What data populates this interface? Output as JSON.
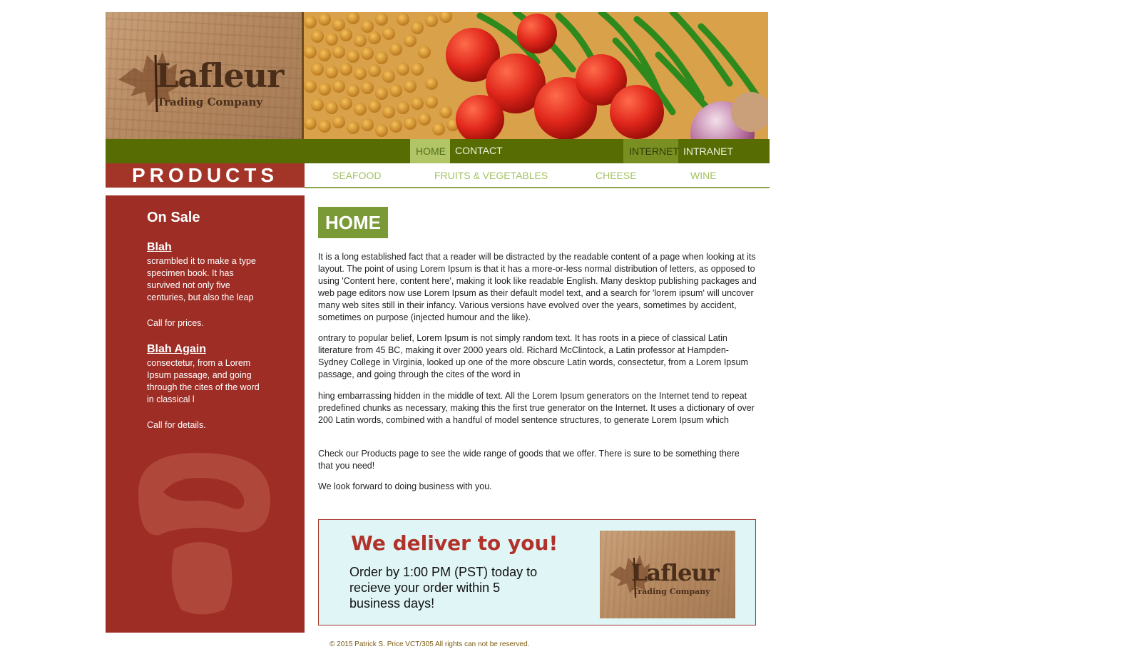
{
  "header": {
    "brand_name": "Lafleur",
    "brand_sub": "Trading Company"
  },
  "topnav": {
    "items": [
      {
        "label": "HOME",
        "state": "active"
      },
      {
        "label": "CONTACT",
        "state": "normal"
      },
      {
        "label": "INTERNET",
        "state": "muted"
      },
      {
        "label": "INTRANET",
        "state": "normal"
      }
    ]
  },
  "products": {
    "title": "PRODUCTS",
    "categories": [
      "SEAFOOD",
      "FRUITS & VEGETABLES",
      "CHEESE",
      "WINE"
    ]
  },
  "sidebar": {
    "heading": "On Sale",
    "items": [
      {
        "link": "Blah",
        "text": "scrambled it to make a type specimen book. It has survived not only five centuries, but also the leap",
        "note": "Call for prices."
      },
      {
        "link": "Blah Again",
        "text": "consectetur, from a Lorem Ipsum passage, and going through the cites of the word in classical l",
        "note": "Call for details."
      }
    ],
    "decor_icon": "mushroom-icon"
  },
  "main": {
    "title": "HOME",
    "paragraphs": [
      "It is a long established fact that a reader will be distracted by the readable content of a page when looking at its layout. The point of using Lorem Ipsum is that it has a more-or-less normal distribution of letters, as opposed to using 'Content here, content here', making it look like readable English. Many desktop publishing packages and web page editors now use Lorem Ipsum as their default model text, and a search for 'lorem ipsum' will uncover many web sites still in their infancy. Various versions have evolved over the years, sometimes by accident, sometimes on purpose (injected humour and the like).",
      "ontrary to popular belief, Lorem Ipsum is not simply random text. It has roots in a piece of classical Latin literature from 45 BC, making it over 2000 years old. Richard McClintock, a Latin professor at Hampden-Sydney College in Virginia, looked up one of the more obscure Latin words, consectetur, from a Lorem Ipsum passage, and going through the cites of the word in",
      "hing embarrassing hidden in the middle of text. All the Lorem Ipsum generators on the Internet tend to repeat predefined chunks as necessary, making this the first true generator on the Internet. It uses a dictionary of over 200 Latin words, combined with a handful of model sentence structures, to generate Lorem Ipsum which",
      "Check our Products page to see the wide range of goods that we offer. There is sure to be something there that you need!",
      "We look forward to doing business with you."
    ]
  },
  "delivery": {
    "heading": "We deliver to you!",
    "body": "Order by 1:00 PM (PST) today to recieve your order within 5 business days!"
  },
  "footer": {
    "text": "© 2015 Patrick S. Price VCT/305 All rights can not be reserved."
  },
  "colors": {
    "nav_green": "#576d04",
    "active_green": "#b1c567",
    "brick_red": "#a33428",
    "title_green": "#7a9a37",
    "category_green": "#a6c164",
    "delivery_bg": "#dff5f6"
  }
}
